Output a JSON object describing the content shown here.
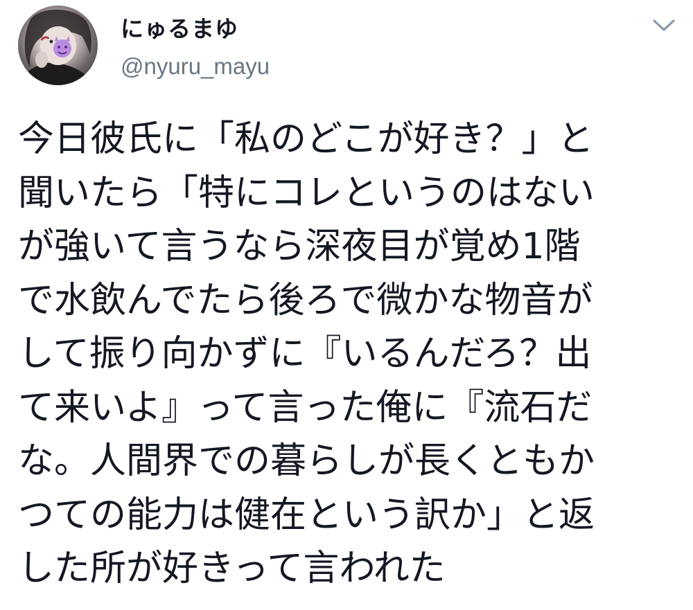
{
  "tweet": {
    "author": {
      "display_name": "にゅるまゆ",
      "handle": "@nyuru_mayu",
      "avatar_icon": "user-avatar-icon",
      "avatar_sticker": "purple-devil-emoji"
    },
    "menu_icon": "chevron-down-icon",
    "text_lines": [
      "今日彼氏に「私のどこが好き？」と",
      "聞いたら「特にコレというのはない",
      "が強いて言うなら深夜目が覚め1階",
      "で水飲んでたら後ろで微かな物音が",
      "して振り向かずに『いるんだろ？出",
      "て来いよ』って言った俺に『流石だ",
      "な。人間界での暮らしが長くともか",
      "つての能力は健在という訳か」と返",
      "した所が好きって言われた"
    ]
  },
  "colors": {
    "text": "#141823",
    "handle": "#687684",
    "icon": "#8899a6",
    "sticker": "#b98be0"
  }
}
